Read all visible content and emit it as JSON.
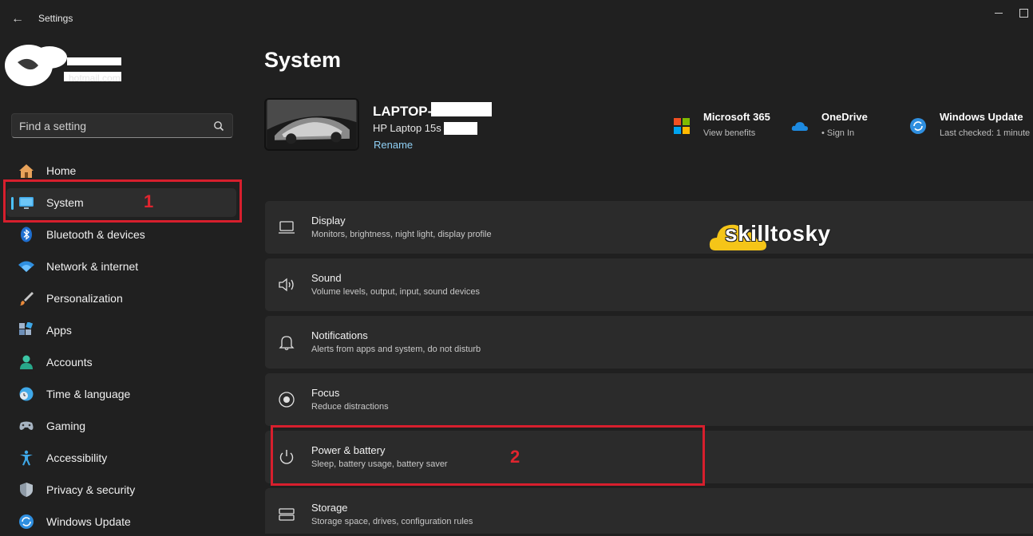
{
  "window": {
    "title": "Settings"
  },
  "account": {
    "email_suffix": "hotmail.com"
  },
  "search": {
    "placeholder": "Find a setting"
  },
  "nav": {
    "items": [
      {
        "label": "Home"
      },
      {
        "label": "System"
      },
      {
        "label": "Bluetooth & devices"
      },
      {
        "label": "Network & internet"
      },
      {
        "label": "Personalization"
      },
      {
        "label": "Apps"
      },
      {
        "label": "Accounts"
      },
      {
        "label": "Time & language"
      },
      {
        "label": "Gaming"
      },
      {
        "label": "Accessibility"
      },
      {
        "label": "Privacy & security"
      },
      {
        "label": "Windows Update"
      }
    ],
    "selected": "System"
  },
  "annotations": {
    "step1": "1",
    "step2": "2"
  },
  "main": {
    "title": "System",
    "device": {
      "name": "LAPTOP-",
      "model": "HP Laptop 15s",
      "rename": "Rename"
    },
    "quick_links": [
      {
        "title": "Microsoft 365",
        "subtitle": "View benefits"
      },
      {
        "title": "OneDrive",
        "subtitle": "• Sign In"
      },
      {
        "title": "Windows Update",
        "subtitle": "Last checked: 1 minute"
      }
    ],
    "cards": [
      {
        "title": "Display",
        "subtitle": "Monitors, brightness, night light, display profile"
      },
      {
        "title": "Sound",
        "subtitle": "Volume levels, output, input, sound devices"
      },
      {
        "title": "Notifications",
        "subtitle": "Alerts from apps and system, do not disturb"
      },
      {
        "title": "Focus",
        "subtitle": "Reduce distractions"
      },
      {
        "title": "Power & battery",
        "subtitle": "Sleep, battery usage, battery saver"
      },
      {
        "title": "Storage",
        "subtitle": "Storage space, drives, configuration rules"
      }
    ]
  },
  "watermark": {
    "text": "skilltosky"
  },
  "colors": {
    "accent": "#4cc2ff",
    "annotation_red": "#d71f2d",
    "background": "#202020",
    "card": "#2b2b2b",
    "watermark_yellow": "#f5c518"
  }
}
